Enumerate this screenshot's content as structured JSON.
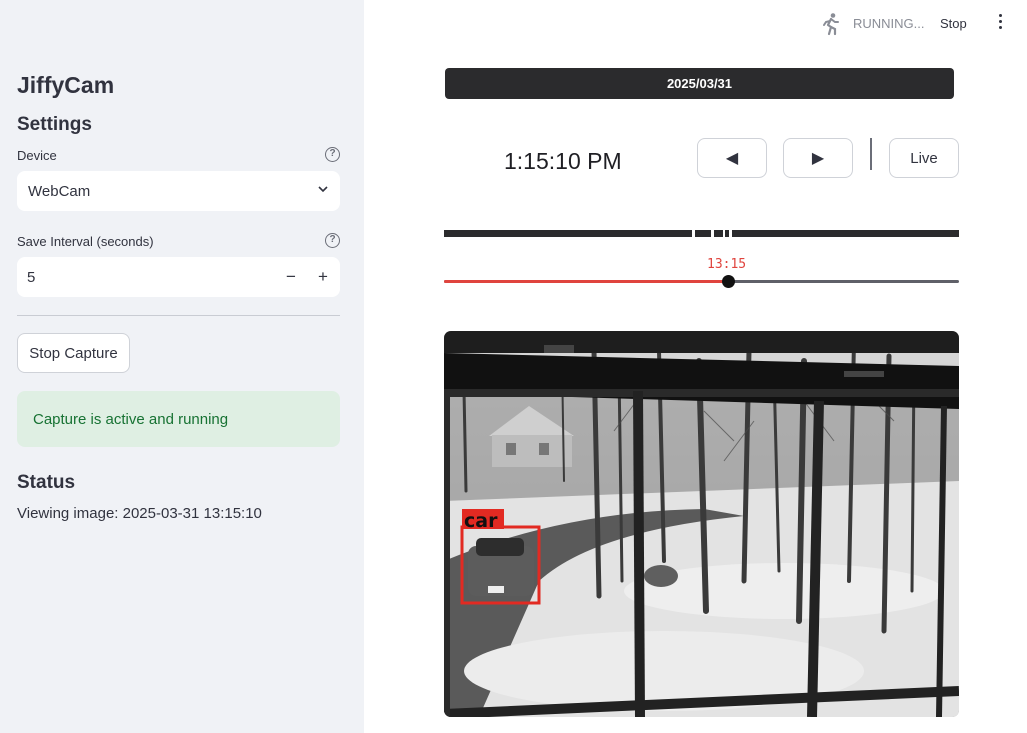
{
  "topbar": {
    "running_label": "RUNNING...",
    "stop_label": "Stop",
    "running_icon": "running-person-icon",
    "menu_icon": "kebab-menu-icon"
  },
  "sidebar": {
    "app_title": "JiffyCam",
    "settings_title": "Settings",
    "device": {
      "label": "Device",
      "value": "WebCam"
    },
    "interval": {
      "label": "Save Interval (seconds)",
      "value": "5",
      "decrement": "−",
      "increment": "+"
    },
    "stop_capture_label": "Stop Capture",
    "alert_text": "Capture is active and running",
    "status_title": "Status",
    "status_text": "Viewing image: 2025-03-31 13:15:10"
  },
  "main": {
    "date_label": "2025/03/31",
    "time_display": "1:15:10 PM",
    "prev_label": "◀",
    "next_label": "▶",
    "live_label": "Live",
    "slider_label": "13:15",
    "slider_fraction": 0.553
  },
  "camera": {
    "detection_label": "car"
  },
  "colors": {
    "sidebar_bg": "#f0f2f6",
    "accent_red": "#e0443e",
    "success_bg": "#dfefe3",
    "success_text": "#177233",
    "dark_bar": "#2b2b2d"
  }
}
